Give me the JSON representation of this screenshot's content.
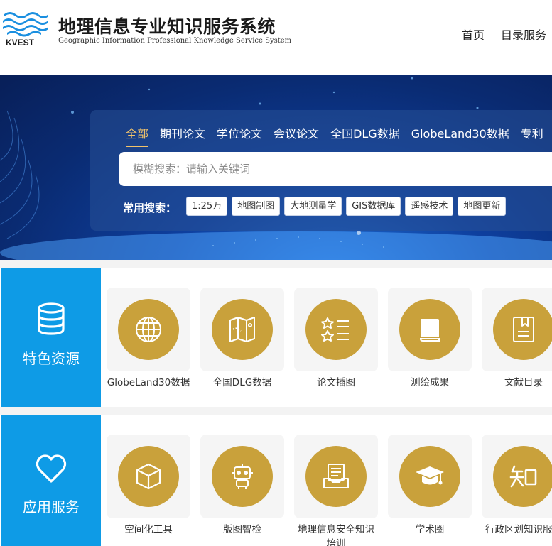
{
  "header": {
    "logo_text": "KVEST",
    "title": "地理信息专业知识服务系统",
    "subtitle": "Geographic Information Professional Knowledge Service System",
    "nav": {
      "home": "首页",
      "catalog": "目录服务"
    }
  },
  "search": {
    "tabs": [
      "全部",
      "期刊论文",
      "学位论文",
      "会议论文",
      "全国DLG数据",
      "GlobeLand30数据",
      "专利"
    ],
    "active_tab": "全部",
    "placeholder": "模糊搜索：请输入关键词",
    "common_label": "常用搜索：",
    "common_items": [
      "1:25万",
      "地图制图",
      "大地测量学",
      "GIS数据库",
      "遥感技术",
      "地图更新"
    ]
  },
  "features": {
    "title": "特色资源",
    "icon": "database-icon",
    "items": [
      {
        "label": "GlobeLand30数据",
        "icon": "globe-icon"
      },
      {
        "label": "全国DLG数据",
        "icon": "map-icon"
      },
      {
        "label": "论文插图",
        "icon": "star-list-icon"
      },
      {
        "label": "测绘成果",
        "icon": "book-icon"
      },
      {
        "label": "文献目录",
        "icon": "document-icon"
      }
    ]
  },
  "services": {
    "title": "应用服务",
    "icon": "heart-icon",
    "items": [
      {
        "label": "空间化工具",
        "icon": "cube-icon"
      },
      {
        "label": "版图智检",
        "icon": "robot-icon"
      },
      {
        "label": "地理信息安全知识培训",
        "icon": "inbox-list-icon"
      },
      {
        "label": "学术圈",
        "icon": "graduation-cap-icon"
      },
      {
        "label": "行政区划知识服务",
        "icon": "zhi-character-icon"
      }
    ]
  },
  "colors": {
    "accent_gold": "#c9a13b",
    "tab_active": "#f2c36b",
    "side_blue": "#0e9be6",
    "banner_blue": "#0a2b72"
  }
}
